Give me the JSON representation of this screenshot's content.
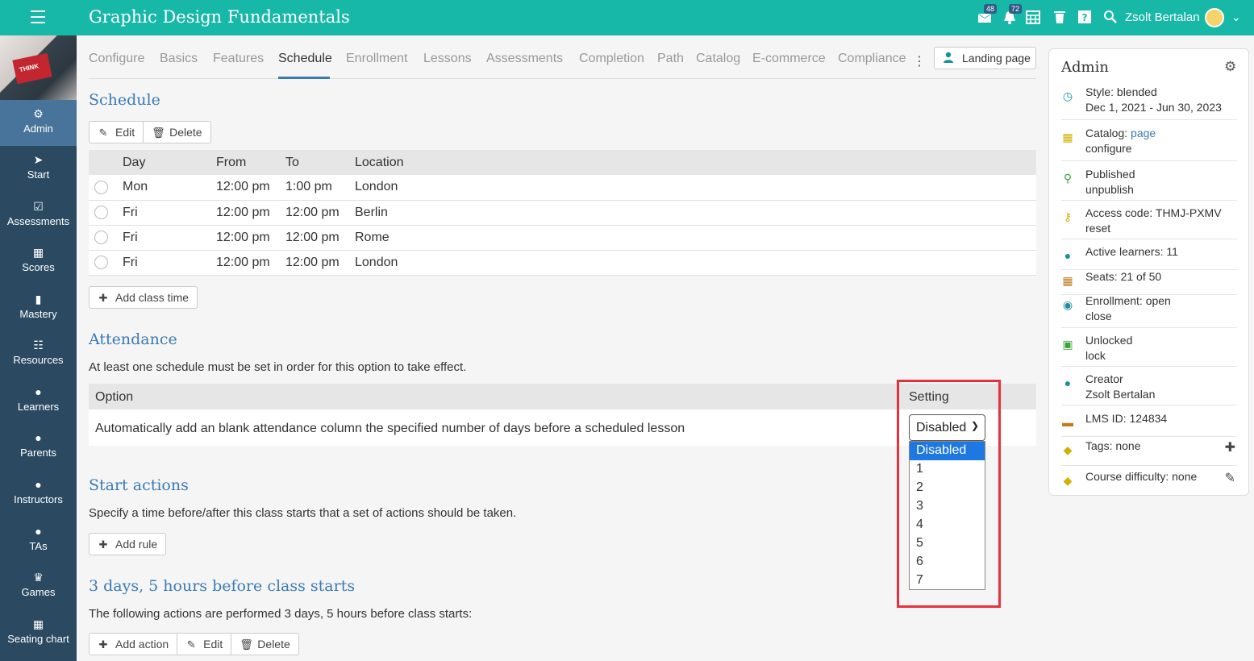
{
  "header": {
    "course_title": "Graphic Design Fundamentals",
    "messages_badge": "48",
    "notifications_badge": "72",
    "user_name": "Zsolt Bertalan"
  },
  "sidebar": {
    "thumbnail_text": "THINK",
    "items": [
      {
        "label": "Admin",
        "icon": "gear-icon"
      },
      {
        "label": "Start",
        "icon": "arrow-icon"
      },
      {
        "label": "Assessments",
        "icon": "checkbox-icon"
      },
      {
        "label": "Scores",
        "icon": "table-icon"
      },
      {
        "label": "Mastery",
        "icon": "bar-chart-icon"
      },
      {
        "label": "Resources",
        "icon": "books-icon"
      },
      {
        "label": "Learners",
        "icon": "person-icon"
      },
      {
        "label": "Parents",
        "icon": "person-icon"
      },
      {
        "label": "Instructors",
        "icon": "person-icon"
      },
      {
        "label": "TAs",
        "icon": "person-icon"
      },
      {
        "label": "Games",
        "icon": "trophy-icon"
      },
      {
        "label": "Seating chart",
        "icon": "grid-icon"
      }
    ]
  },
  "tabs": [
    "Configure",
    "Basics",
    "Features",
    "Schedule",
    "Enrollment",
    "Lessons",
    "Assessments",
    "Completion",
    "Path",
    "Catalog",
    "E-commerce",
    "Compliance"
  ],
  "landing_page_label": "Landing page",
  "schedule": {
    "title": "Schedule",
    "edit_label": "Edit",
    "delete_label": "Delete",
    "columns": [
      "Day",
      "From",
      "To",
      "Location"
    ],
    "rows": [
      [
        "Mon",
        "12:00 pm",
        "1:00 pm",
        "London"
      ],
      [
        "Fri",
        "12:00 pm",
        "12:00 pm",
        "Berlin"
      ],
      [
        "Fri",
        "12:00 pm",
        "12:00 pm",
        "Rome"
      ],
      [
        "Fri",
        "12:00 pm",
        "12:00 pm",
        "London"
      ]
    ],
    "add_class_time_label": "Add class time"
  },
  "attendance": {
    "title": "Attendance",
    "note": "At least one schedule must be set in order for this option to take effect.",
    "col_option": "Option",
    "col_setting": "Setting",
    "option_text": "Automatically add an blank attendance column the specified number of days before a scheduled lesson",
    "selected_value": "Disabled",
    "options": [
      "Disabled",
      "1",
      "2",
      "3",
      "4",
      "5",
      "6",
      "7"
    ]
  },
  "start_actions": {
    "title": "Start actions",
    "note": "Specify a time before/after this class starts that a set of actions should be taken.",
    "add_rule_label": "Add rule"
  },
  "rule": {
    "title": "3 days, 5 hours before class starts",
    "note": "The following actions are performed 3 days, 5 hours before class starts:",
    "add_action_label": "Add action",
    "edit_label": "Edit",
    "delete_label": "Delete"
  },
  "admin_panel": {
    "title": "Admin",
    "style_line": "Style: blended",
    "dates": "Dec 1, 2021 - Jun 30, 2023",
    "catalog_label": "Catalog:",
    "catalog_link": "page",
    "catalog_configure": "configure",
    "published": "Published",
    "unpublish": "unpublish",
    "access_code": "Access code: THMJ-PXMV",
    "reset": "reset",
    "active_learners": "Active learners: 11",
    "seats": "Seats: 21 of 50",
    "enrollment": "Enrollment: open",
    "close": "close",
    "unlocked": "Unlocked",
    "lock": "lock",
    "creator_label": "Creator",
    "creator_name": "Zsolt Bertalan",
    "lms_id": "LMS ID: 124834",
    "tags": "Tags: none",
    "difficulty": "Course difficulty: none"
  },
  "colors": {
    "topbar": "#18b8a8",
    "sidebar": "#2b4a62",
    "accent": "#3a7bb5",
    "highlight": "#e8313d",
    "selected_option": "#1e78e4"
  }
}
